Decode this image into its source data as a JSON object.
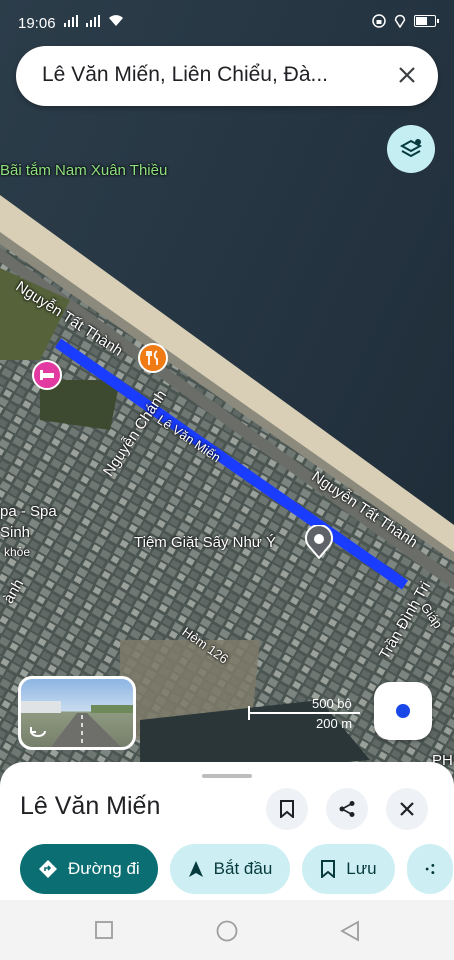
{
  "status": {
    "time": "19:06"
  },
  "search": {
    "query": "Lê Văn Miến, Liên Chiểu, Đà..."
  },
  "map_labels": {
    "beach": "Bãi tắm Nam Xuân Thiều",
    "road_nguyen_tat_thanh_1": "Nguyễn Tất Thành",
    "road_nguyen_tat_thanh_2": "Nguyễn Tất Thành",
    "road_le_van_mien": "Lê Văn Miến",
    "road_nguyen_chanh": "Nguyễn Chánh",
    "poi_laundry": "Tiệm Giặt Sấy Như Ý",
    "road_tran_dinh_tri": "Trần Đình Tri",
    "road_hem_126": "Hẻm 126",
    "spa_1": "pa - Spa",
    "spa_2": "Sinh",
    "spa_3": "khỏe",
    "road_left": "ành",
    "road_right": "Giáp",
    "right_edge": "PH"
  },
  "scale": {
    "top": "500 bộ",
    "bottom": "200 m"
  },
  "place": {
    "title": "Lê Văn Miến"
  },
  "actions": {
    "directions": "Đường đi",
    "start": "Bắt đầu",
    "save": "Lưu"
  },
  "colors": {
    "route": "#1a3cff",
    "primary": "#0b6e72",
    "chip": "#cdeff3"
  }
}
